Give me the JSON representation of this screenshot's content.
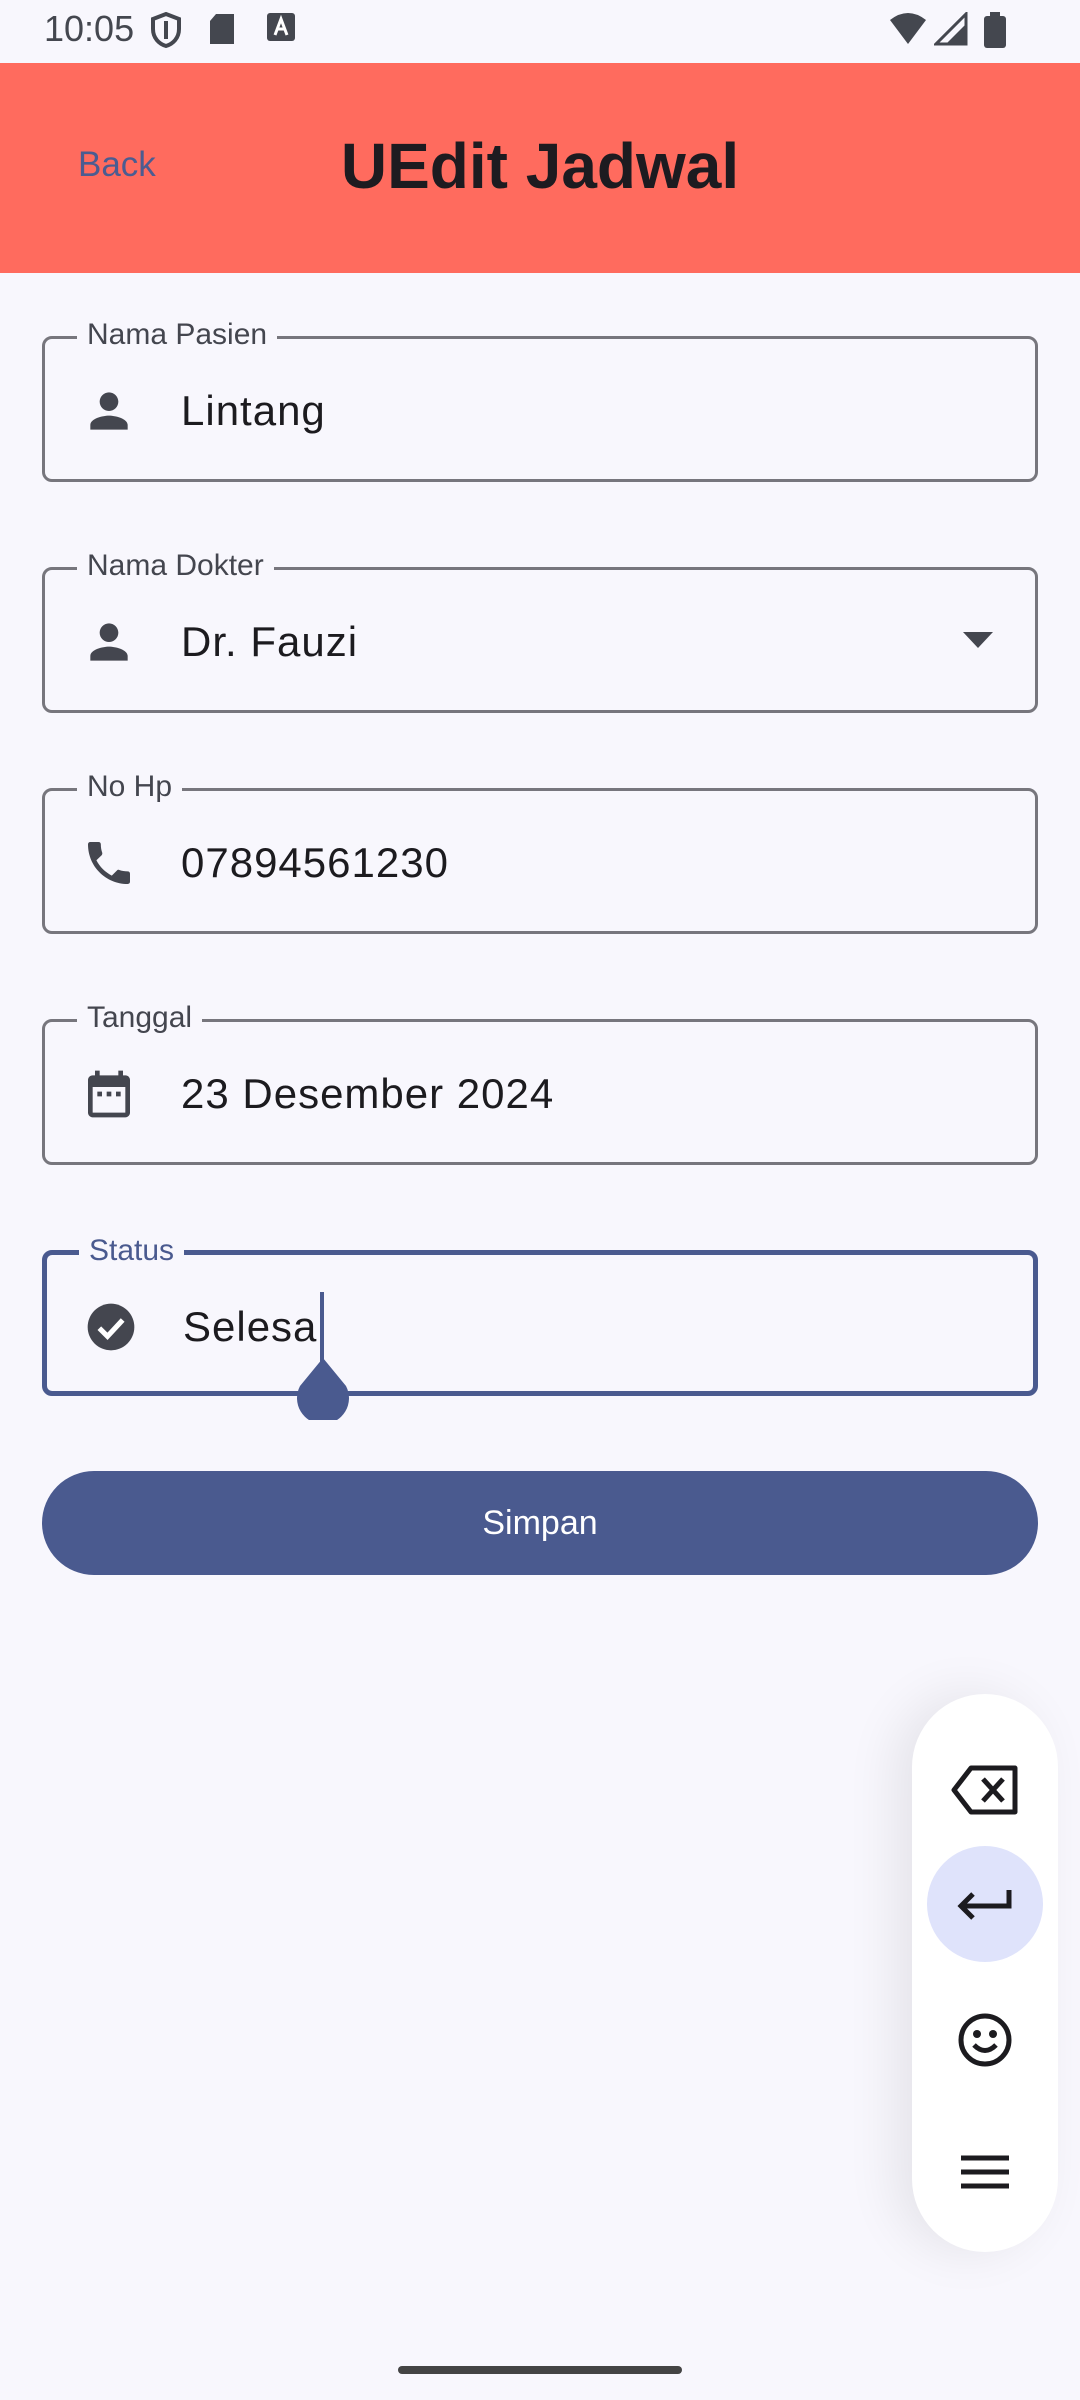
{
  "status_bar": {
    "time": "10:05"
  },
  "app_bar": {
    "back_label": "Back",
    "title": "UEdit Jadwal"
  },
  "form": {
    "nama_pasien": {
      "label": "Nama Pasien",
      "value": "Lintang",
      "icon": "person-icon"
    },
    "nama_dokter": {
      "label": "Nama Dokter",
      "value": "Dr. Fauzi",
      "icon": "person-icon"
    },
    "no_hp": {
      "label": "No Hp",
      "value": "07894561230",
      "icon": "phone-icon"
    },
    "tanggal": {
      "label": "Tanggal",
      "value": "23 Desember 2024",
      "icon": "calendar-icon"
    },
    "status": {
      "label": "Status",
      "value": "Selesai",
      "icon": "check-circle-icon"
    },
    "save_label": "Simpan"
  },
  "keyboard_panel": {
    "buttons": [
      "backspace-icon",
      "enter-icon",
      "emoji-icon",
      "menu-icon"
    ]
  },
  "colors": {
    "app_bar": "#ff6b5e",
    "accent": "#4a5a8f",
    "background": "#f8f7fd"
  }
}
